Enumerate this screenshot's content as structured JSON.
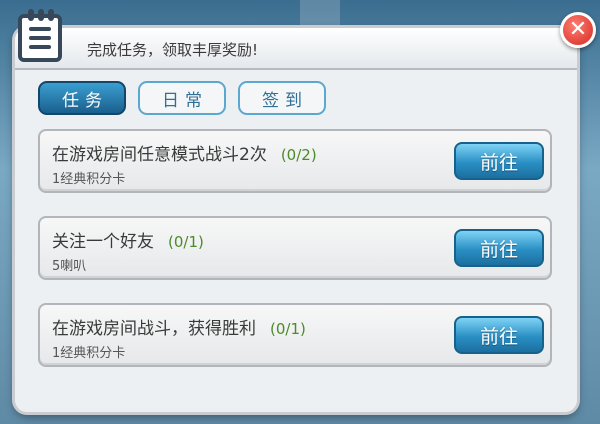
{
  "header": {
    "title": "完成任务，领取丰厚奖励!"
  },
  "tabs": [
    {
      "label": "任务",
      "active": true
    },
    {
      "label": "日常",
      "active": false
    },
    {
      "label": "签到",
      "active": false
    }
  ],
  "tasks": [
    {
      "title": "在游戏房间任意模式战斗2次",
      "progress": "(0/2)",
      "reward": "1经典积分卡",
      "button": "前往"
    },
    {
      "title": "关注一个好友",
      "progress": "(0/1)",
      "reward": "5喇叭",
      "button": "前往"
    },
    {
      "title": "在游戏房间战斗，获得胜利",
      "progress": "(0/1)",
      "reward": "1经典积分卡",
      "button": "前往"
    }
  ],
  "icons": {
    "header": "clipboard-icon",
    "close": "close-icon"
  },
  "colors": {
    "accent": "#1a5f8e",
    "close": "#d42a22",
    "progress": "#4c8a2a"
  }
}
